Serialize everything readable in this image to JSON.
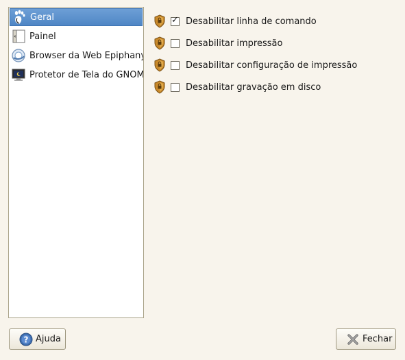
{
  "sidebar": {
    "items": [
      {
        "label": "Geral",
        "icon": "gnome-foot-icon",
        "selected": true
      },
      {
        "label": "Painel",
        "icon": "panel-icon",
        "selected": false
      },
      {
        "label": "Browser da Web Epiphany",
        "icon": "web-browser-globe-icon",
        "selected": false
      },
      {
        "label": "Protetor de Tela do GNOME",
        "icon": "screensaver-monitor-icon",
        "selected": false
      }
    ]
  },
  "options": [
    {
      "label": "Desabilitar linha de comando",
      "checked": true,
      "icon": "lock-shield-icon"
    },
    {
      "label": "Desabilitar impressão",
      "checked": false,
      "icon": "lock-shield-icon"
    },
    {
      "label": "Desabilitar configuração de impressão",
      "checked": false,
      "icon": "lock-shield-icon"
    },
    {
      "label": "Desabilitar gravação em disco",
      "checked": false,
      "icon": "lock-shield-icon"
    }
  ],
  "buttons": {
    "help_label": "Ajuda",
    "close_label": "Fechar"
  },
  "colors": {
    "window_bg": "#f8f4ec",
    "selection": "#5a8fcb",
    "lock_shield": "#c8892b"
  }
}
